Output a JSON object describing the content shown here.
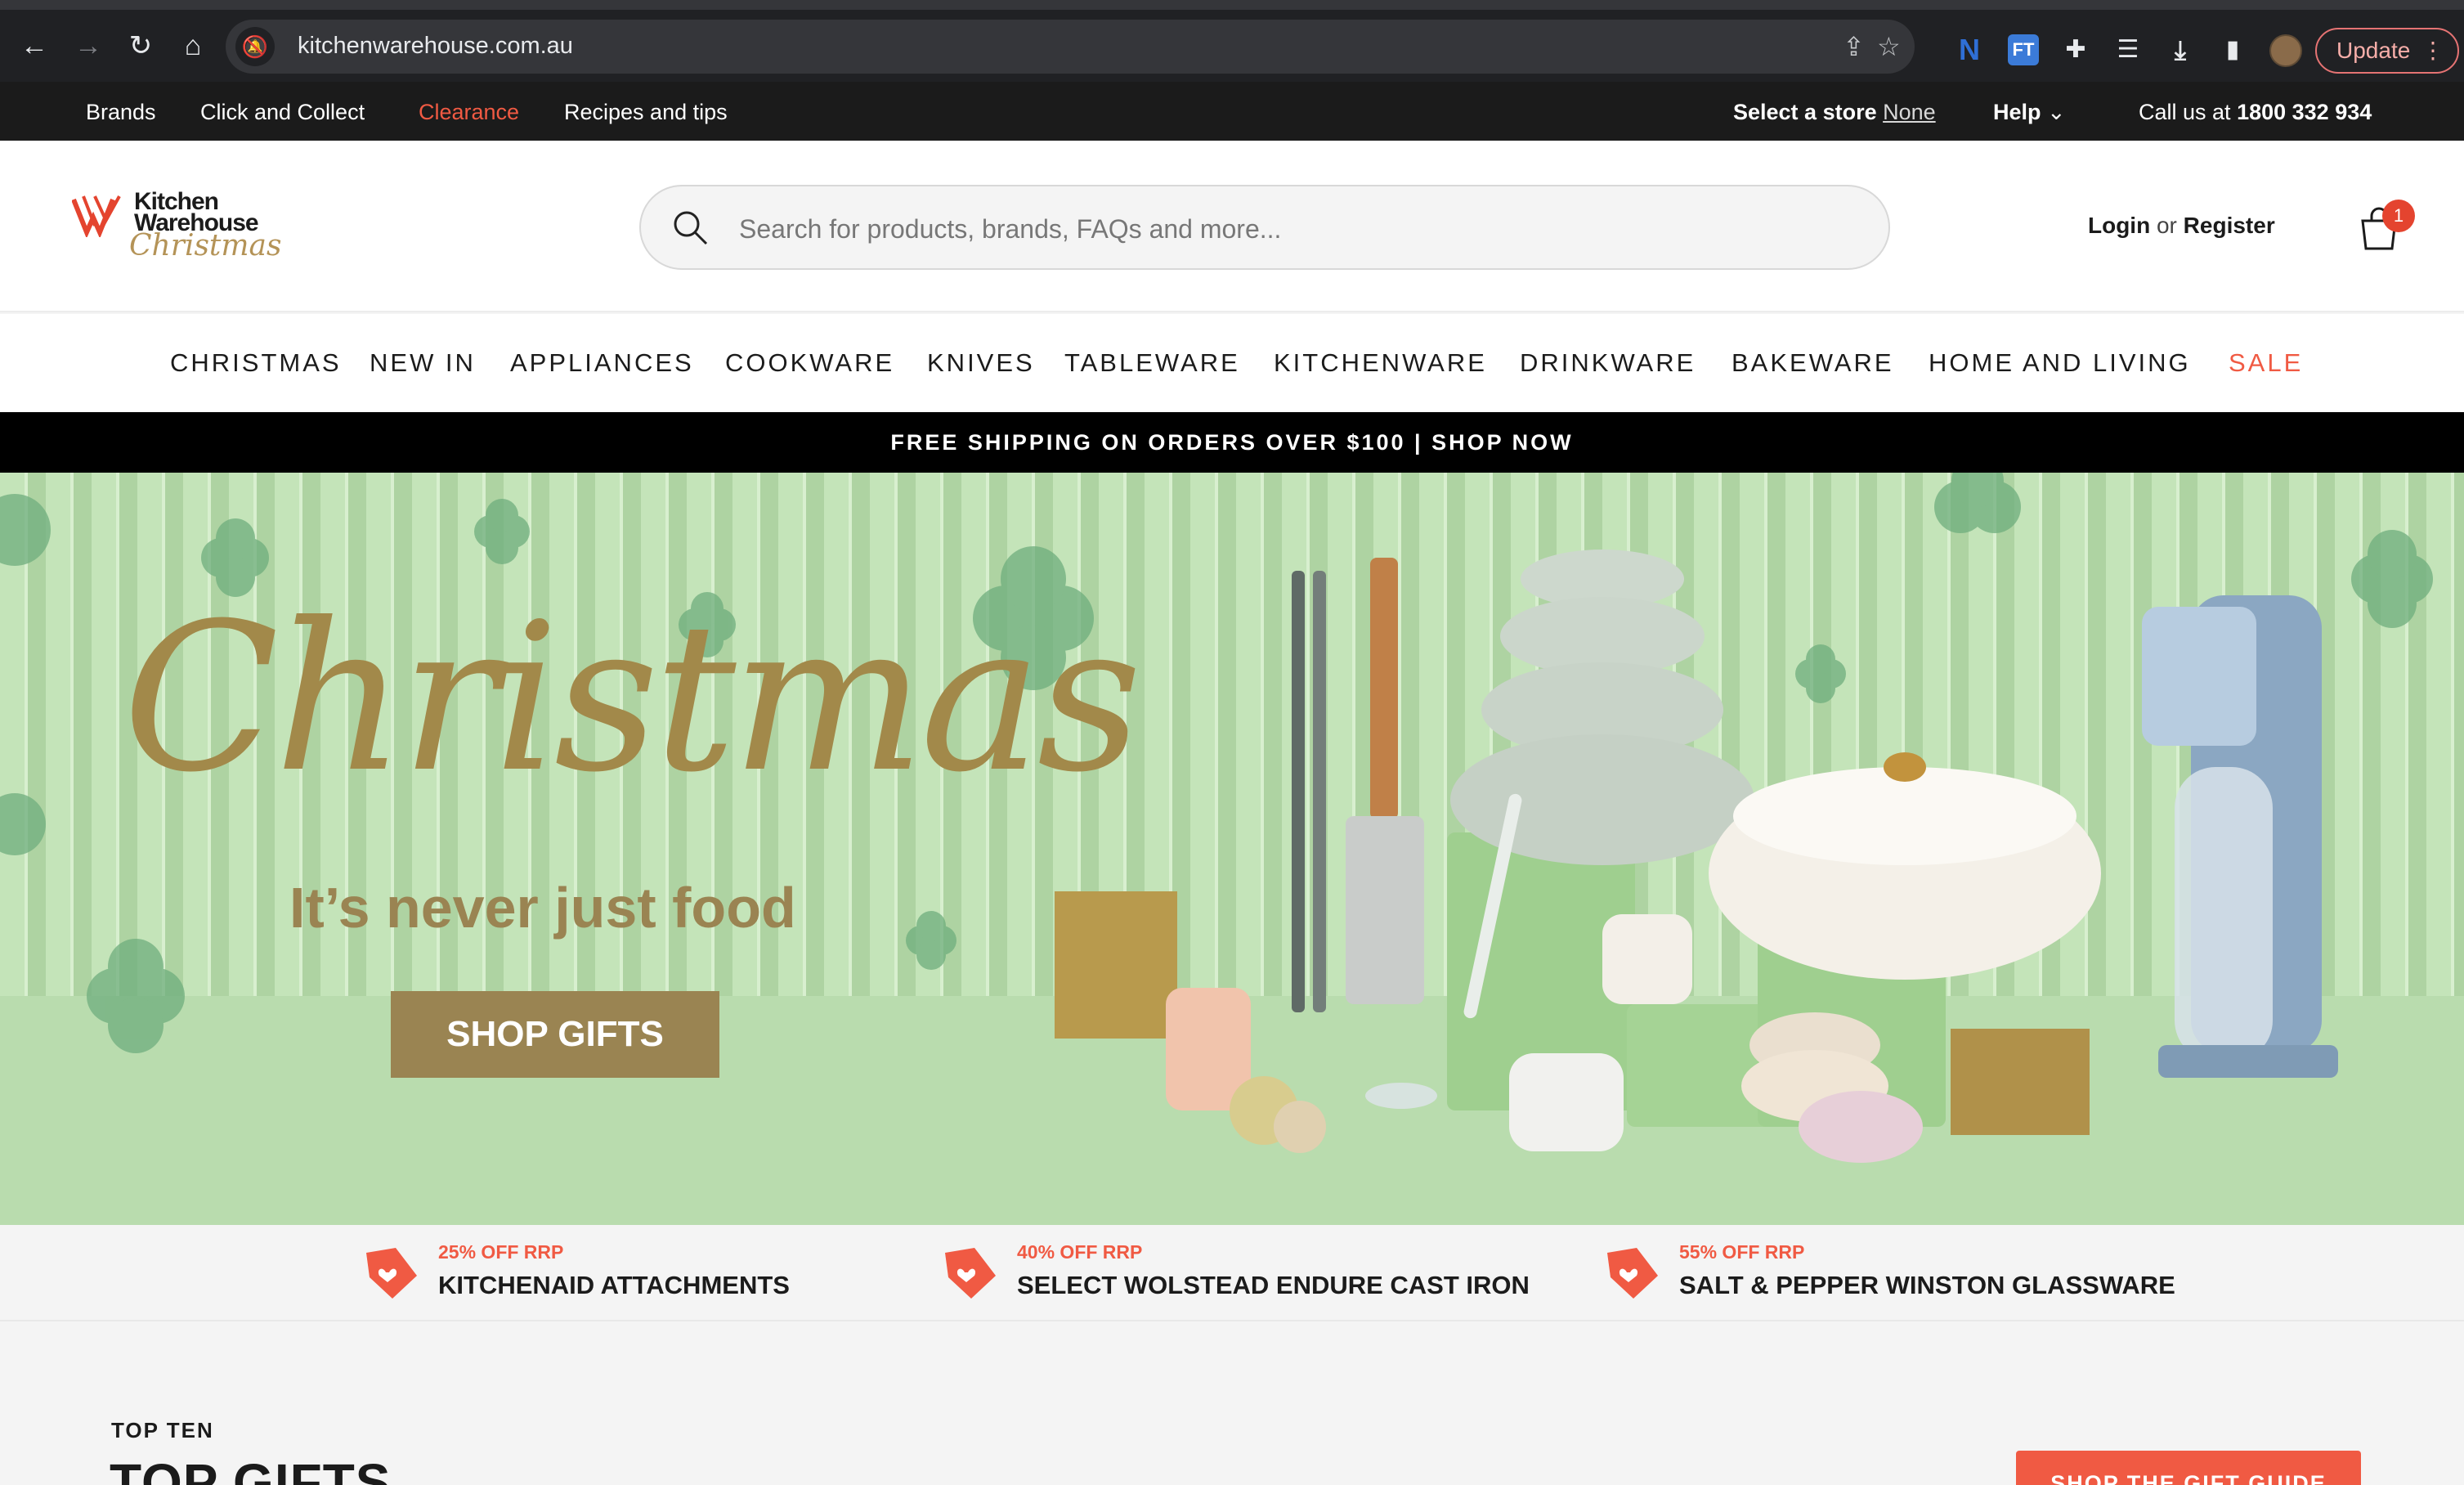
{
  "browser": {
    "url": "kitchenwarehouse.com.au",
    "update_label": "Update",
    "icons": [
      "back-icon",
      "forward-icon",
      "reload-icon",
      "home-icon",
      "site-info-icon",
      "share-icon",
      "bookmark-star-icon",
      "extension-n-icon",
      "extension-ft-icon",
      "extensions-puzzle-icon",
      "media-icon",
      "download-icon",
      "side-panel-icon",
      "profile-avatar",
      "more-menu-icon"
    ],
    "ext_n": "N",
    "ext_ft": "FT"
  },
  "utility": {
    "brands": "Brands",
    "click_collect": "Click and Collect",
    "clearance": "Clearance",
    "recipes": "Recipes and tips",
    "select_store_label": "Select a store",
    "select_store_value": "None",
    "help": "Help",
    "call_prefix": "Call us at",
    "phone": "1800 332 934"
  },
  "header": {
    "logo_line1": "Kitchen",
    "logo_line2": "Warehouse",
    "logo_line3": "Christmas",
    "search_placeholder": "Search for products, brands, FAQs and more...",
    "login": "Login",
    "or": "or",
    "register": "Register",
    "cart_count": "1"
  },
  "categories": [
    "CHRISTMAS",
    "NEW IN",
    "APPLIANCES",
    "COOKWARE",
    "KNIVES",
    "TABLEWARE",
    "KITCHENWARE",
    "DRINKWARE",
    "BAKEWARE",
    "HOME AND LIVING",
    "SALE"
  ],
  "promo": "FREE SHIPPING ON ORDERS OVER $100 | SHOP NOW",
  "hero": {
    "title": "Christmas",
    "subtitle": "It’s never just food",
    "cta": "SHOP GIFTS"
  },
  "deals": [
    {
      "pct": "25% OFF RRP",
      "name": "KITCHENAID ATTACHMENTS"
    },
    {
      "pct": "40% OFF RRP",
      "name": "SELECT WOLSTEAD ENDURE CAST IRON"
    },
    {
      "pct": "55% OFF RRP",
      "name": "SALT & PEPPER WINSTON GLASSWARE"
    }
  ],
  "section": {
    "eyebrow": "TOP TEN",
    "heading": "TOP GIFTS",
    "button": "SHOP THE GIFT GUIDE"
  },
  "colors": {
    "accent_red": "#f05a43",
    "gold": "#9a8452",
    "hero_green": "#bfe0b4"
  }
}
